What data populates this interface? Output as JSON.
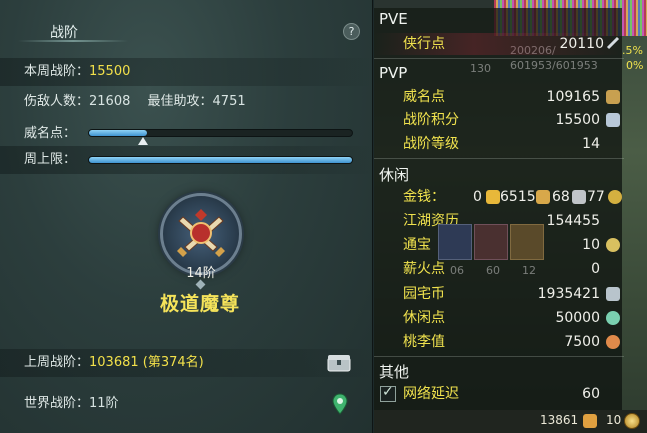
{
  "left_panel": {
    "title": "战阶",
    "help_label": "?",
    "weekly_rank": {
      "label": "本周战阶：",
      "value": "15500"
    },
    "kills": {
      "label": "伤敌人数：",
      "value": "21608"
    },
    "assist": {
      "label": "最佳助攻：",
      "value": "4751"
    },
    "fame": {
      "label": "威名点：",
      "progress": 0.22
    },
    "weekly_cap": {
      "label": "周上限：",
      "progress": 1.0
    },
    "rank": {
      "tier": "14阶",
      "name": "极道魔尊"
    },
    "last_week": {
      "label": "上周战阶：",
      "value": "103681 (第374名)"
    },
    "world": {
      "label": "世界战阶：",
      "value": "11阶"
    }
  },
  "right_panel": {
    "sections": {
      "pve": "PVE",
      "pvp": "PVP",
      "leisure": "休闲",
      "other": "其他"
    },
    "pve_rows": [
      {
        "key": "侠行点",
        "value": "20110"
      }
    ],
    "pvp_rows": [
      {
        "key": "威名点",
        "value": "109165"
      },
      {
        "key": "战阶积分",
        "value": "15500"
      },
      {
        "key": "战阶等级",
        "value": "14"
      }
    ],
    "money": {
      "key": "金钱：",
      "v0": "0",
      "v1": "6515",
      "v2": "68",
      "v3": "77"
    },
    "leisure_rows": [
      {
        "key": "江湖资历",
        "value": "154455"
      },
      {
        "key": "通宝",
        "value": "10"
      },
      {
        "key": "薪火点",
        "value": "0"
      },
      {
        "key": "园宅币",
        "value": "1935421"
      },
      {
        "key": "休闲点",
        "value": "50000"
      },
      {
        "key": "桃李值",
        "value": "7500"
      }
    ],
    "other_rows": [
      {
        "key": "网络延迟",
        "value": "60"
      }
    ],
    "bottom": {
      "value1": "13861",
      "value2": "10"
    },
    "background_text": {
      "hp": "200206/",
      "mp": "601953/601953",
      "lvl": "130",
      "pct1": ".5%",
      "pct2": "0%",
      "cd1": "06",
      "cd2": "60",
      "cd3": "12"
    }
  },
  "colors": {
    "accent_yellow": "#f2e04a",
    "bar_blue": "#4f9fd8",
    "panel_bg": "#2c3e3d"
  }
}
